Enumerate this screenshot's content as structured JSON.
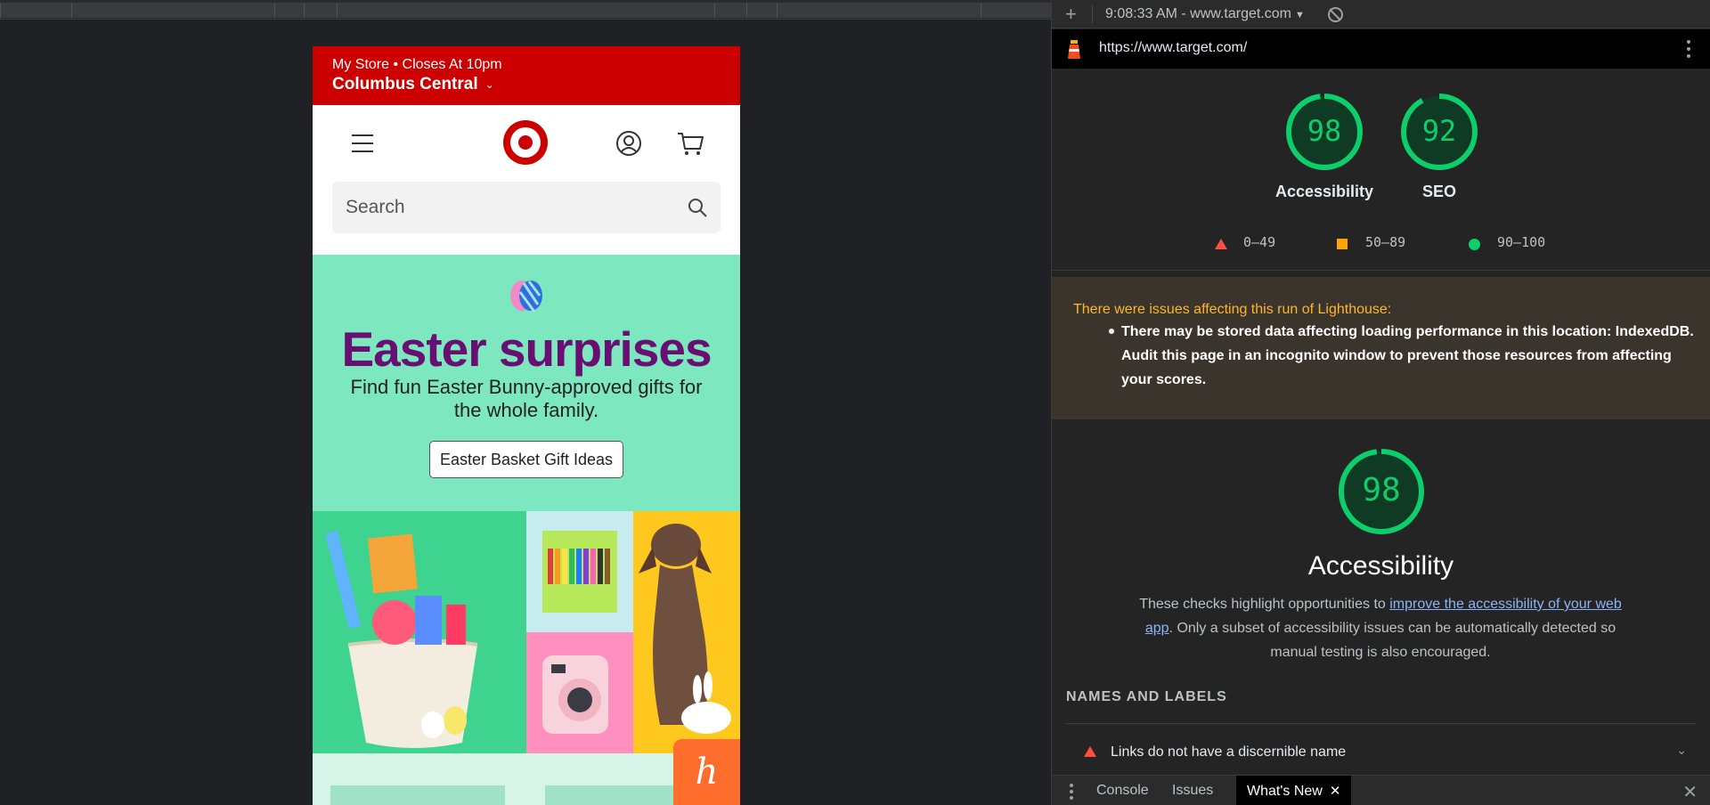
{
  "phone": {
    "store_line1": "My Store • Closes At 10pm",
    "store_name": "Columbus Central",
    "search_placeholder": "Search",
    "hero_title": "Easter surprises",
    "hero_subtitle": "Find fun Easter Bunny-approved gifts for the whole family.",
    "hero_button": "Easter Basket Gift Ideas",
    "honey_glyph": "h"
  },
  "devtools": {
    "run_select": "9:08:33 AM - www.target.com",
    "url": "https://www.target.com/",
    "gauges": [
      {
        "score": 98,
        "label": "Accessibility"
      },
      {
        "score": 92,
        "label": "SEO"
      }
    ],
    "legend": {
      "fail": "0–49",
      "average": "50–89",
      "pass": "90–100"
    },
    "warning_title": "There were issues affecting this run of Lighthouse:",
    "warning_item": "There may be stored data affecting loading performance in this location: IndexedDB. Audit this page in an incognito window to prevent those resources from affecting your scores.",
    "category": {
      "score": 98,
      "title": "Accessibility",
      "desc_before": "These checks highlight opportunities to ",
      "desc_link": "improve the accessibility of your web app",
      "desc_after": ". Only a subset of accessibility issues can be automatically detected so manual testing is also encouraged."
    },
    "group_title": "NAMES AND LABELS",
    "audit_text": "Links do not have a discernible name",
    "drawer_tabs": [
      "Console",
      "Issues",
      "What's New"
    ],
    "colors": {
      "pass": "#0cce6b",
      "average": "#ffa400",
      "fail": "#ff4e42",
      "brand": "#cc0000"
    }
  }
}
